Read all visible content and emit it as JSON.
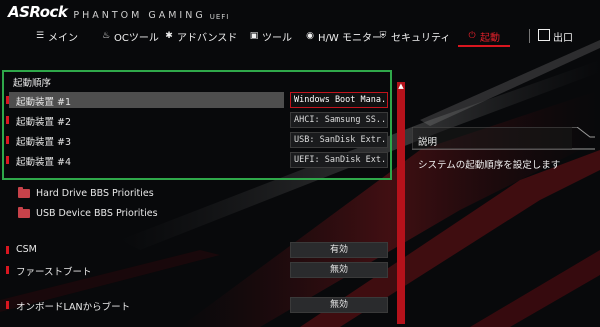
{
  "brand": {
    "logo": "ASRock",
    "name": "PHANTOM GAMING",
    "uefi": "UEFI"
  },
  "nav": {
    "items": [
      {
        "label": "メイン",
        "icon": "list-icon"
      },
      {
        "label": "OCツール",
        "icon": "flame-icon"
      },
      {
        "label": "アドバンスド",
        "icon": "star-icon"
      },
      {
        "label": "ツール",
        "icon": "toolbox-icon"
      },
      {
        "label": "H/W モニター",
        "icon": "monitor-gauge-icon"
      },
      {
        "label": "セキュリティ",
        "icon": "shield-icon"
      },
      {
        "label": "起動",
        "icon": "power-icon",
        "active": true
      },
      {
        "label": "出口",
        "icon": "exit-icon"
      }
    ]
  },
  "boot_order": {
    "title": "起動順序",
    "devices": [
      {
        "label": "起動装置 #1",
        "value": "Windows Boot Mana..."
      },
      {
        "label": "起動装置 #2",
        "value": "AHCI:  Samsung SS..."
      },
      {
        "label": "起動装置 #3",
        "value": "USB: SanDisk Extr..."
      },
      {
        "label": "起動装置 #4",
        "value": "UEFI: SanDisk Ext..."
      }
    ]
  },
  "folders": [
    {
      "label": "Hard Drive BBS Priorities",
      "icon": "folder-icon"
    },
    {
      "label": "USB Device BBS Priorities",
      "icon": "folder-icon"
    }
  ],
  "options": [
    {
      "label": "CSM",
      "value": "有効"
    },
    {
      "label": "ファーストブート",
      "value": "無効"
    },
    {
      "label": "オンボードLANからブート",
      "value": "無効"
    }
  ],
  "description": {
    "title": "説明",
    "text": "システムの起動順序を設定します"
  },
  "colors": {
    "accent": "#d9161f",
    "highlight": "#2fa84a",
    "background": "#08090b"
  }
}
